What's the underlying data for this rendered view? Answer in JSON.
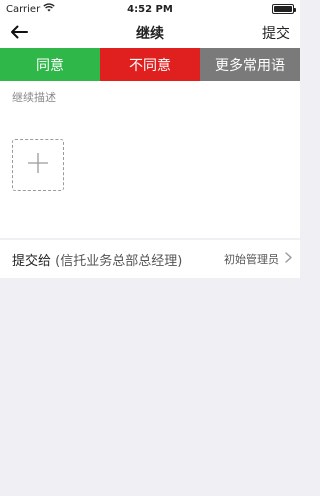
{
  "status_bar": {
    "carrier": "Carrier",
    "time": "4:52 PM",
    "wifi_icon": "wifi-icon",
    "battery_icon": "battery-icon"
  },
  "nav": {
    "title": "继续",
    "submit_label": "提交",
    "back_icon": "arrow-left-icon"
  },
  "quick_actions": [
    {
      "label": "同意",
      "color": "#2fb74a"
    },
    {
      "label": "不同意",
      "color": "#e0201f"
    },
    {
      "label": "更多常用语",
      "color": "#7a7a7a"
    }
  ],
  "description": {
    "placeholder": "继续描述",
    "add_icon": "plus-icon"
  },
  "submit_to": {
    "label": "提交给",
    "role": "(信托业务总部总经理)",
    "assignee": "初始管理员",
    "chevron_icon": "chevron-right-icon"
  }
}
